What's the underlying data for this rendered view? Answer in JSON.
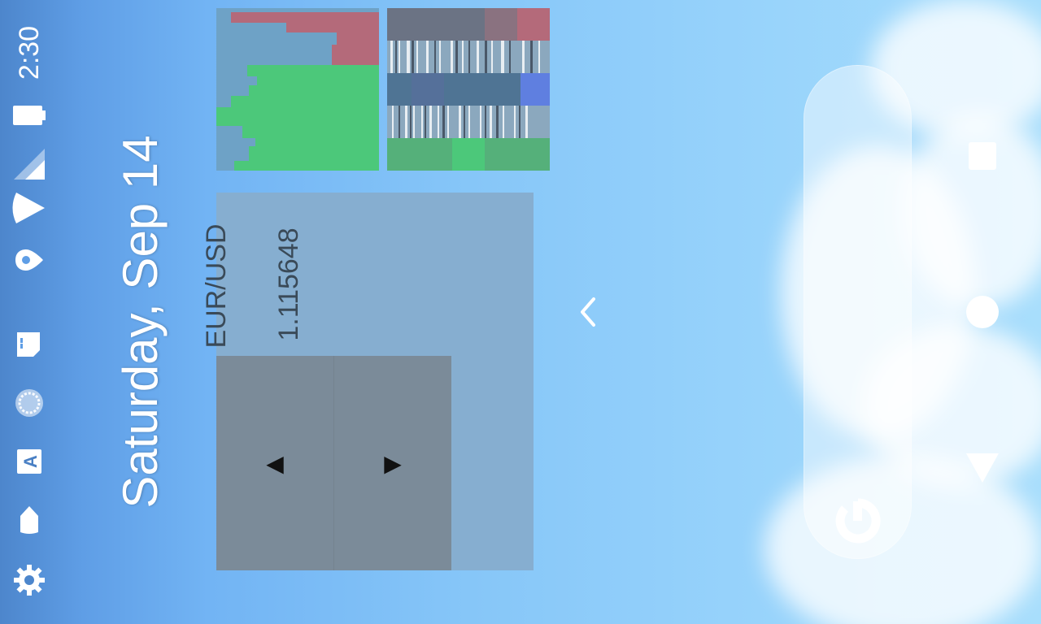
{
  "status_bar": {
    "time": "2:30",
    "icons": [
      "battery-icon",
      "cell-signal-icon",
      "wifi-icon",
      "location-icon",
      "sd-card-icon",
      "sync-icon",
      "a-notification-icon",
      "tag-icon",
      "settings-icon"
    ]
  },
  "home": {
    "date": "Saturday, Sep 14"
  },
  "currency_widget": {
    "pair": "EUR/USD",
    "rate": "1.115648",
    "prev_label": "◀",
    "next_label": "▶"
  },
  "search": {
    "icon": "google-g-icon"
  },
  "nav": {
    "buttons": [
      "recents-button",
      "home-button",
      "back-button"
    ]
  },
  "colors": {
    "wallpaper_sky": "#86c6f8",
    "widget_background": "#86aed0",
    "widget_button": "#7b8b99",
    "thumb_green": "#4cc87a",
    "thumb_red": "#b46a7a",
    "thumb_blue": "#5f7fe0"
  }
}
